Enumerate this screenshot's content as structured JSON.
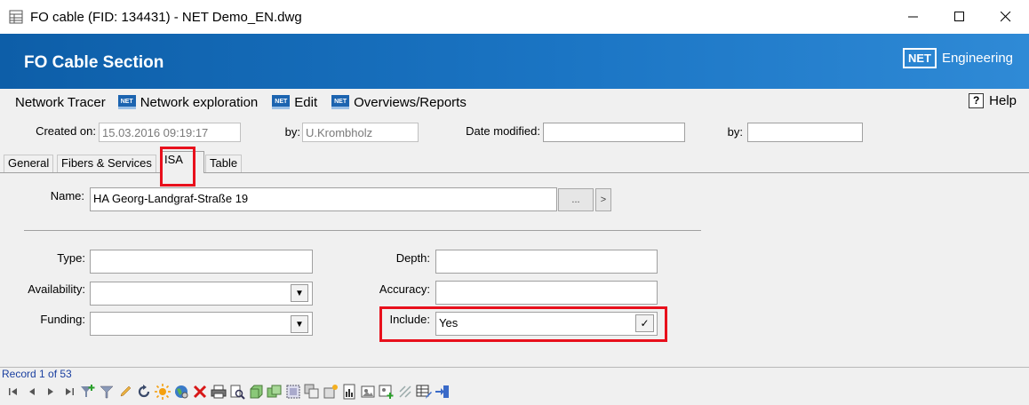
{
  "window": {
    "title": "FO cable (FID: 134431) - NET Demo_EN.dwg",
    "controls": {
      "minimize": "—",
      "maximize": "☐",
      "close": "✕"
    }
  },
  "banner": {
    "title": "FO Cable Section",
    "brand_box": "NET",
    "brand_text": "Engineering"
  },
  "menu": {
    "items": [
      {
        "label": "Network Tracer",
        "icon": ""
      },
      {
        "label": "Network exploration",
        "icon": "net-icon"
      },
      {
        "label": "Edit",
        "icon": "net-icon"
      },
      {
        "label": "Overviews/Reports",
        "icon": "net-icon"
      }
    ],
    "help": "Help",
    "net_icon_text": "NET"
  },
  "meta": {
    "created_on_label": "Created on:",
    "created_on_value": "15.03.2016 09:19:17",
    "by_label": "by:",
    "by_value": "U.Krombholz",
    "date_modified_label": "Date modified:",
    "date_modified_value": "",
    "by2_label": "by:",
    "by2_value": ""
  },
  "tabs": [
    {
      "label": "General"
    },
    {
      "label": "Fibers & Services"
    },
    {
      "label": "ISA"
    },
    {
      "label": "Table"
    }
  ],
  "isa": {
    "name_label": "Name:",
    "name_value": "HA Georg-Landgraf-Straße 19",
    "ellipsis": "...",
    "goto": ">",
    "type_label": "Type:",
    "type_value": "",
    "availability_label": "Availability:",
    "availability_value": "",
    "funding_label": "Funding:",
    "funding_value": "",
    "depth_label": "Depth:",
    "depth_value": "",
    "accuracy_label": "Accuracy:",
    "accuracy_value": "",
    "include_label": "Include:",
    "include_value": "Yes",
    "dropdown_glyph": "▼",
    "check_glyph": "✓"
  },
  "status": {
    "record": "Record 1 of 53"
  },
  "toolbar_icons": [
    "first-record-icon",
    "prev-record-icon",
    "next-record-icon",
    "last-record-icon",
    "add-filter-icon",
    "filter-icon",
    "edit-pencil-icon",
    "refresh-icon",
    "highlight-sun-icon",
    "globe-icon",
    "delete-icon",
    "print-icon",
    "print-preview-icon",
    "object-icon",
    "objects-icon",
    "select-icon",
    "copy-icon",
    "new-icon",
    "report-icon",
    "image-icon",
    "image-add-icon",
    "connect-icon",
    "table-edit-icon",
    "exit-icon"
  ],
  "colors": {
    "banner": "#1b75c4",
    "highlight": "#e8101c",
    "record_text": "#1a3fa0"
  }
}
